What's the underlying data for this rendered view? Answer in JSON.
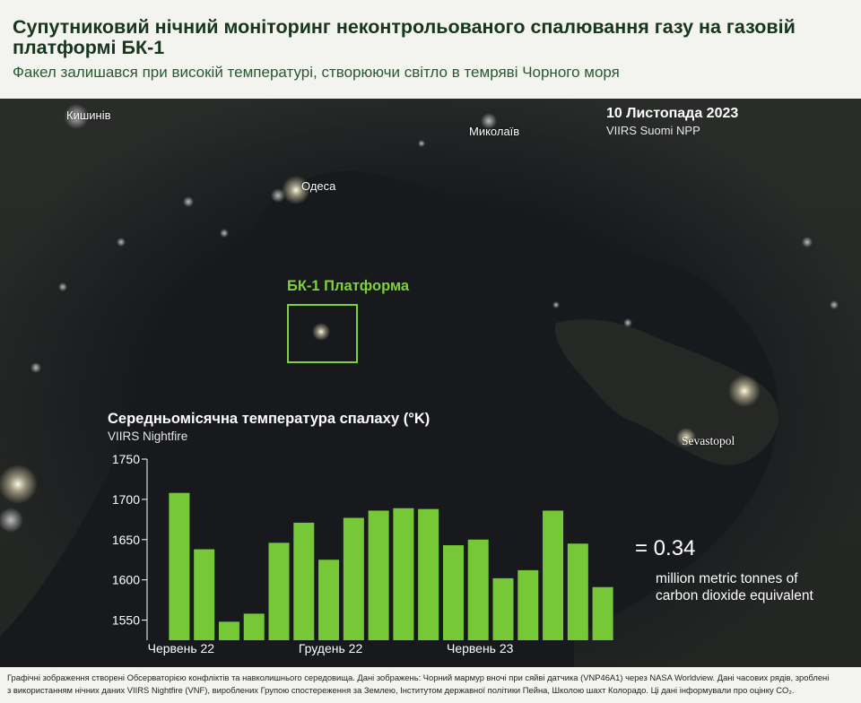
{
  "header": {
    "title": "Супутниковий нічний моніторинг неконтрольованого спалювання газу на газовій платформі БК-1",
    "subtitle": "Факел залишався при високій температурі, створюючи світло в темряві Чорного моря"
  },
  "map": {
    "date": "10 Листопада 2023",
    "satellite": "VIIRS Suomi NPP",
    "cities": {
      "chisinau": "Кишинів",
      "mykolaiv": "Миколаїв",
      "odesa": "Одеса",
      "sevastopol": "Sevastopol"
    },
    "platform_label": "БК-1 Платформа"
  },
  "annotation": {
    "value": "= 0.34",
    "unit": "million metric tonnes of carbon dioxide equivalent"
  },
  "colors": {
    "bar": "#77c836",
    "accent": "#7ed23a",
    "title": "#17361c"
  },
  "chart_data": {
    "type": "bar",
    "title": "Середньомісячна температура спалаху (°K)",
    "subtitle": "VIIRS Nightfire",
    "x_tick_labels": [
      "Червень 22",
      "Грудень 22",
      "Червень 23"
    ],
    "x_tick_positions": [
      0,
      6,
      12
    ],
    "values": [
      1708,
      1638,
      1548,
      1558,
      1646,
      1671,
      1625,
      1677,
      1686,
      1689,
      1688,
      1643,
      1650,
      1602,
      1612,
      1686,
      1645,
      1591
    ],
    "ylim": [
      1525,
      1750
    ],
    "yticks": [
      1550,
      1600,
      1650,
      1700,
      1750
    ],
    "grid": false
  },
  "footer": {
    "line1": "Графічні зображення створені Обсерваторією конфліктів та навколишнього середовища. Дані зображень: Чорний мармур вночі при сяйві датчика (VNP46A1) через NASA Worldview. Дані часових рядів, зроблені",
    "line2": "з використанням нічних даних VIIRS Nightfire (VNF), вироблених Групою спостереження за Землею, Інститутом державної політики Пейна, Школою шахт Колорадо. Ці дані інформували про оцінку CO₂."
  }
}
